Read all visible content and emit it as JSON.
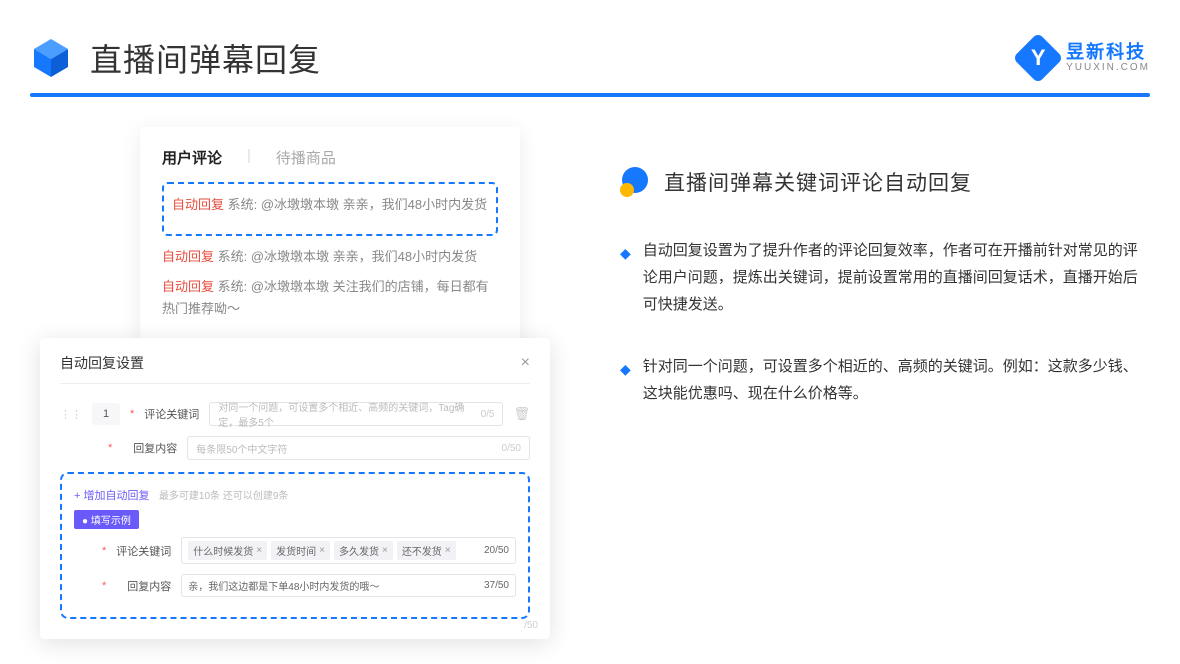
{
  "header": {
    "title": "直播间弹幕回复",
    "brand_name": "昱新科技",
    "brand_url": "YUUXIN.COM",
    "brand_letter": "Y"
  },
  "comments_panel": {
    "tab_active": "用户评论",
    "tab_inactive": "待播商品",
    "highlighted": {
      "tag": "自动回复",
      "text": "系统: @冰墩墩本墩 亲亲，我们48小时内发货"
    },
    "rows": [
      {
        "tag": "自动回复",
        "text": "系统: @冰墩墩本墩 亲亲，我们48小时内发货"
      },
      {
        "tag": "自动回复",
        "text": "系统: @冰墩墩本墩 关注我们的店铺，每日都有热门推荐呦～"
      }
    ]
  },
  "settings_panel": {
    "title": "自动回复设置",
    "index": "1",
    "keyword_label": "评论关键词",
    "keyword_placeholder": "对同一个问题，可设置多个相近、高频的关键词，Tag确定，最多5个",
    "keyword_counter": "0/5",
    "content_label": "回复内容",
    "content_placeholder": "每条限50个中文字符",
    "content_counter": "0/50",
    "add_text": "+ 增加自动回复",
    "add_hint": "最多可建10条 还可以创建9条",
    "example_badge": "● 填写示例",
    "example_keyword_label": "评论关键词",
    "example_tags": [
      "什么时候发货",
      "发货时间",
      "多久发货",
      "还不发货"
    ],
    "example_kw_counter": "20/50",
    "example_content_label": "回复内容",
    "example_content_text": "亲，我们这边都是下单48小时内发货的哦～",
    "example_content_counter": "37/50",
    "ghost_counter": "/50"
  },
  "right": {
    "section_title": "直播间弹幕关键词评论自动回复",
    "bullets": [
      "自动回复设置为了提升作者的评论回复效率，作者可在开播前针对常见的评论用户问题，提炼出关键词，提前设置常用的直播间回复话术，直播开始后可快捷发送。",
      "针对同一个问题，可设置多个相近的、高频的关键词。例如：这款多少钱、这块能优惠吗、现在什么价格等。"
    ]
  }
}
